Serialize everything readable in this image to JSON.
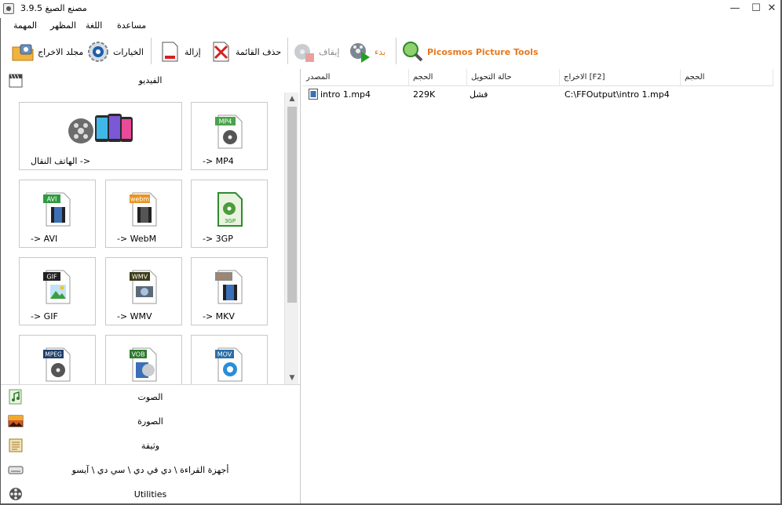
{
  "window": {
    "title": "مصنع الصيغ 3.9.5",
    "minimize_glyph": "—",
    "maximize_glyph": "☐",
    "close_glyph": "✕"
  },
  "menu": [
    "المهمة",
    "المظهر",
    "اللغة",
    "مساعدة"
  ],
  "toolbar": {
    "output_folder": "مجلد الاخراج",
    "options": "الخيارات",
    "remove": "إزالة",
    "clear_list": "حذف القائمة",
    "stop": "إيقاف",
    "start": "بدء",
    "picosmos": "Picosmos Picture Tools"
  },
  "video_category": {
    "label": "الفيديو",
    "icon": "film-icon"
  },
  "tiles": [
    {
      "label": "الهاتف النقال ->",
      "icon": "mobile-devices-icon"
    },
    {
      "label": "-> MP4",
      "badge": "MP4",
      "icon": "mp4-file-icon"
    },
    {
      "label": "-> AVI",
      "badge": "AVI",
      "icon": "avi-file-icon"
    },
    {
      "label": "-> WebM",
      "badge": "webm",
      "icon": "webm-file-icon"
    },
    {
      "label": "-> 3GP",
      "badge": "3GP",
      "icon": "3gp-file-icon"
    },
    {
      "label": "-> GIF",
      "badge": "GIF",
      "icon": "gif-file-icon"
    },
    {
      "label": "-> WMV",
      "badge": "WMV",
      "icon": "wmv-file-icon"
    },
    {
      "label": "-> MKV",
      "badge": "MKV",
      "icon": "mkv-file-icon"
    },
    {
      "label": "",
      "badge": "MPEG",
      "icon": "mpeg-file-icon"
    },
    {
      "label": "",
      "badge": "VOB",
      "icon": "vob-file-icon"
    },
    {
      "label": "",
      "badge": "MOV",
      "icon": "mov-file-icon"
    }
  ],
  "bottom_categories": [
    {
      "label": "الصوت",
      "icon": "audio-icon"
    },
    {
      "label": "الصورة",
      "icon": "picture-icon"
    },
    {
      "label": "وثيقة",
      "icon": "document-icon"
    },
    {
      "label": "أجهزة القراءة \\ دي في دي \\ سي دي \\ آيسو",
      "icon": "rom-device-icon"
    },
    {
      "label": "Utilities",
      "icon": "utilities-icon"
    }
  ],
  "list": {
    "columns": [
      "المصدر",
      "الحجم",
      "حالة التحويل",
      "الاخراج [F2]",
      "الحجم"
    ],
    "rows": [
      {
        "source": "intro 1.mp4",
        "size": "229K",
        "status": "فشل",
        "output": "C:\\FFOutput\\intro 1.mp4",
        "out_size": ""
      }
    ]
  },
  "colors": {
    "accent_orange": "#e8781c",
    "disabled_text": "#8a8a8a"
  }
}
